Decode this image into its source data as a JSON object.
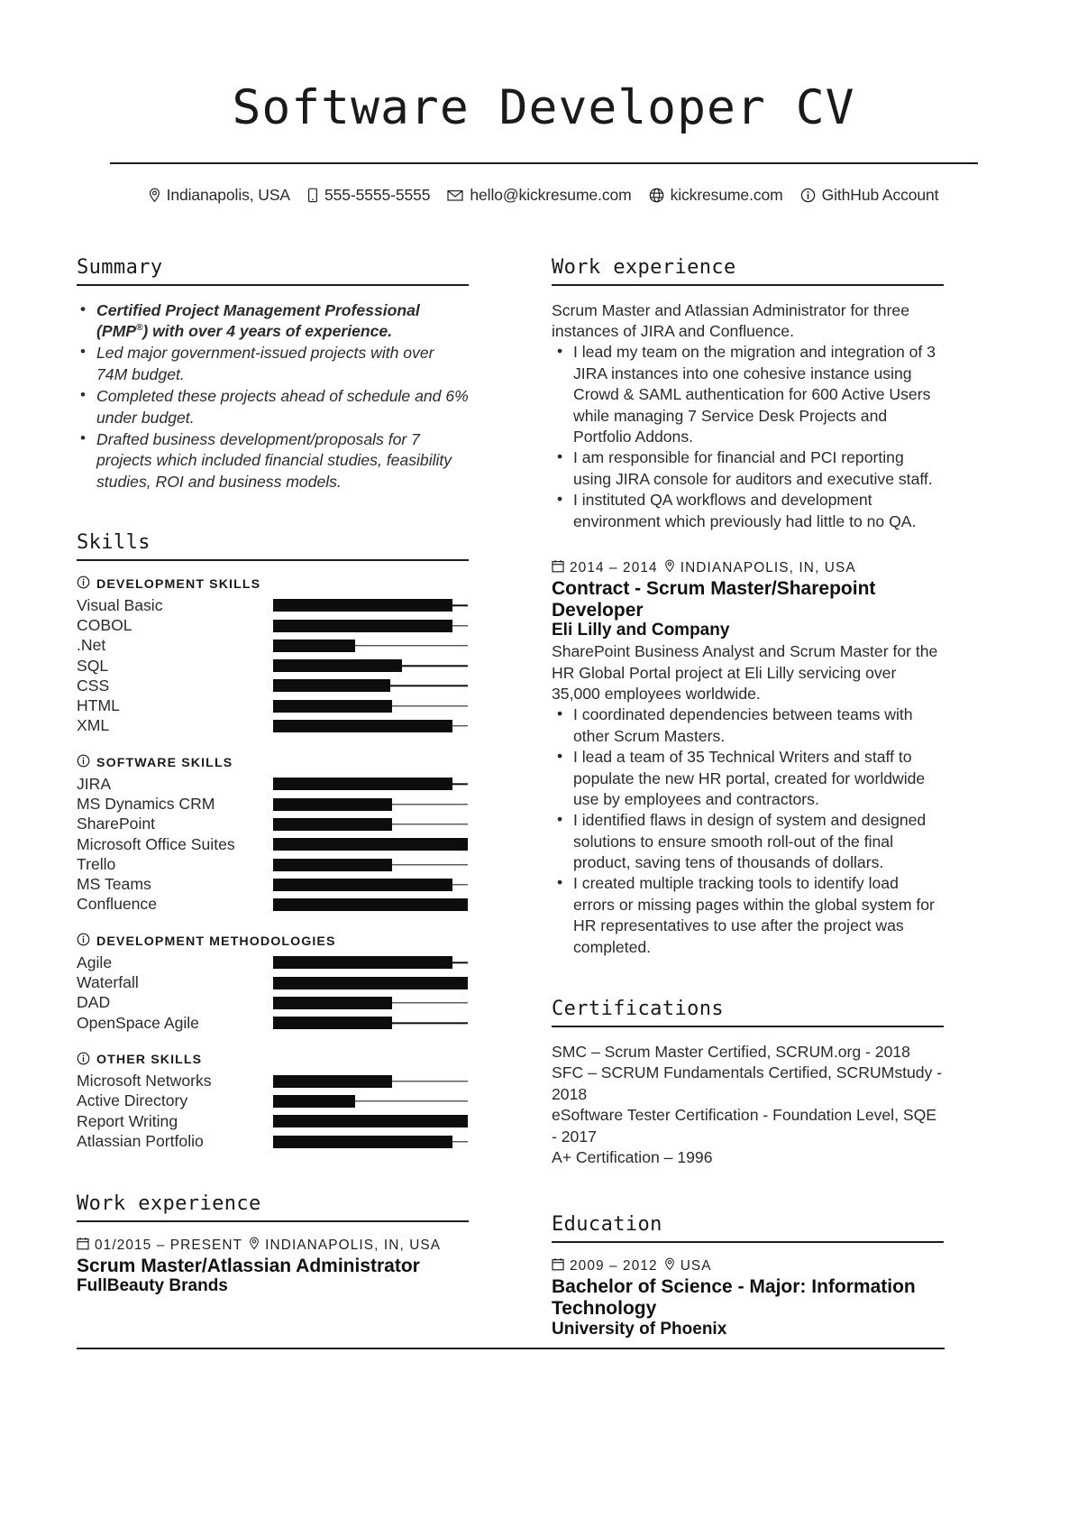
{
  "header": {
    "title": "Software Developer CV",
    "contacts": [
      {
        "icon": "location-pin-icon",
        "text": "Indianapolis, USA"
      },
      {
        "icon": "phone-icon",
        "text": "555-5555-5555"
      },
      {
        "icon": "envelope-icon",
        "text": "hello@kickresume.com"
      },
      {
        "icon": "globe-icon",
        "text": "kickresume.com"
      },
      {
        "icon": "info-circle-icon",
        "text": "GithHub Account"
      }
    ]
  },
  "summary": {
    "heading": "Summary",
    "bullets": [
      "Certified Project Management Professional (PMP®) with over 4 years of experience.",
      "Led major government-issued projects with over 74M budget.",
      "Completed these projects ahead of schedule and 6% under budget.",
      "Drafted business development/proposals for 7 projects which included financial studies, feasibility studies, ROI and business models."
    ]
  },
  "skills": {
    "heading": "Skills",
    "groups": [
      {
        "label": "DEVELOPMENT SKILLS",
        "icon": "info-circle-icon",
        "items": [
          {
            "name": "Visual Basic",
            "level": 92
          },
          {
            "name": "COBOL",
            "level": 92
          },
          {
            "name": ".Net",
            "level": 42
          },
          {
            "name": "SQL",
            "level": 66
          },
          {
            "name": "CSS",
            "level": 60
          },
          {
            "name": "HTML",
            "level": 61
          },
          {
            "name": "XML",
            "level": 92
          }
        ]
      },
      {
        "label": "SOFTWARE SKILLS",
        "icon": "info-circle-icon",
        "items": [
          {
            "name": "JIRA",
            "level": 92
          },
          {
            "name": "MS Dynamics CRM",
            "level": 61
          },
          {
            "name": "SharePoint",
            "level": 61
          },
          {
            "name": "Microsoft Office Suites",
            "level": 100
          },
          {
            "name": "Trello",
            "level": 61
          },
          {
            "name": "MS Teams",
            "level": 92
          },
          {
            "name": "Confluence",
            "level": 100
          }
        ]
      },
      {
        "label": "DEVELOPMENT METHODOLOGIES",
        "icon": "info-circle-icon",
        "items": [
          {
            "name": "Agile",
            "level": 92
          },
          {
            "name": "Waterfall",
            "level": 100
          },
          {
            "name": "DAD",
            "level": 61
          },
          {
            "name": "OpenSpace Agile",
            "level": 61
          }
        ]
      },
      {
        "label": "OTHER SKILLS",
        "icon": "info-circle-icon",
        "items": [
          {
            "name": "Microsoft Networks",
            "level": 61
          },
          {
            "name": "Active Directory",
            "level": 42
          },
          {
            "name": "Report Writing",
            "level": 100
          },
          {
            "name": "Atlassian Portfolio",
            "level": 92
          }
        ]
      }
    ]
  },
  "work_left": {
    "heading": "Work experience",
    "date": "01/2015 – PRESENT",
    "date_icon": "calendar-icon",
    "location": "INDIANAPOLIS, IN, USA",
    "location_icon": "location-pin-icon",
    "title": "Scrum Master/Atlassian Administrator",
    "company": "FullBeauty Brands"
  },
  "work_right": {
    "heading": "Work experience",
    "job1": {
      "intro": "Scrum Master and Atlassian Administrator for three instances of JIRA and Confluence.",
      "bullets": [
        "I lead my team on the migration and integration of 3 JIRA instances into one cohesive instance using Crowd & SAML authentication for 600 Active Users while managing 7 Service Desk Projects and Portfolio Addons.",
        "I am responsible for financial and PCI reporting using JIRA console for auditors and executive staff.",
        "I instituted QA workflows and development environment which previously had little to no QA."
      ]
    },
    "job2": {
      "date": "2014 – 2014",
      "date_icon": "calendar-icon",
      "location": "INDIANAPOLIS, IN, USA",
      "location_icon": "location-pin-icon",
      "title": "Contract - Scrum Master/Sharepoint Developer",
      "company": "Eli Lilly and Company",
      "intro": "SharePoint Business Analyst and Scrum Master for the HR Global Portal project at Eli Lilly servicing over 35,000 employees worldwide.",
      "bullets": [
        "I coordinated dependencies between teams with other Scrum Masters.",
        "I lead a team of 35 Technical Writers and staff to populate the new HR portal, created for worldwide use by employees and contractors.",
        "I identified flaws in design of system and designed solutions to ensure smooth roll-out of the final product, saving tens of thousands of dollars.",
        "I created multiple tracking tools to identify load errors or missing pages within the global system for HR representatives to use after the project was completed."
      ]
    }
  },
  "certifications": {
    "heading": "Certifications",
    "lines": [
      "SMC – Scrum Master Certified, SCRUM.org - 2018",
      "SFC – SCRUM Fundamentals Certified, SCRUMstudy - 2018",
      "eSoftware Tester Certification - Foundation Level, SQE - 2017",
      "A+ Certification – 1996"
    ]
  },
  "education": {
    "heading": "Education",
    "date": "2009 – 2012",
    "date_icon": "calendar-icon",
    "location": "USA",
    "location_icon": "location-pin-icon",
    "degree": "Bachelor of Science - Major: Information Technology",
    "school": "University of Phoenix"
  }
}
